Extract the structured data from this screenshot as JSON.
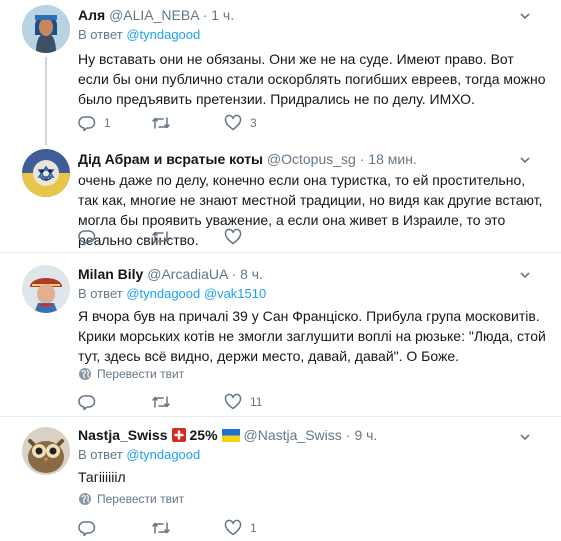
{
  "tweets": [
    {
      "name": "Аля",
      "badge": "",
      "handle": "@ALIA_NEBA",
      "dot": "·",
      "time": "1 ч.",
      "reply_prefix": "В ответ",
      "reply_to": "@tyndagood",
      "reply_to_2": "",
      "text": "Ну вставать они не обязаны. Они же не на суде. Имеют право. Вот если бы они публично стали оскорблять погибших евреев, тогда можно было предъявить претензии. Придрались не по делу. ИМХО.",
      "translate": "",
      "replies": "1",
      "retweets": "",
      "likes": "3"
    },
    {
      "name": "Дід Абрам и всратые коты",
      "badge": "",
      "handle": "@Octopus_sg",
      "dot": "·",
      "time": "18 мин.",
      "reply_prefix": "",
      "reply_to": "",
      "reply_to_2": "",
      "text": "очень даже по делу, конечно если она туристка, то ей простительно, так как, многие не знают местной традиции, но видя как другие встают, могла бы проявить уважение, а если она живет в Израиле, то это реально свинство.",
      "translate": "",
      "replies": "",
      "retweets": "",
      "likes": ""
    },
    {
      "name": "Milan Bily",
      "badge": "",
      "handle": "@ArcadiaUA",
      "dot": "·",
      "time": "8 ч.",
      "reply_prefix": "В ответ",
      "reply_to": "@tyndagood",
      "reply_to_2": "@vak1510",
      "text": "Я вчора був на причалі 39 у Сан Франціско. Прибула група московитів. Крики морських котів не змогли заглушити воплі на рюзьке: \"Люда, стой тут, здесь всё видно, держи место, давай, давай\". О Боже.",
      "translate": "Перевести твит",
      "replies": "",
      "retweets": "",
      "likes": "11"
    },
    {
      "name": "Nastja_Swiss",
      "badge": "25%",
      "handle": "@Nastja_Swiss",
      "dot": "·",
      "time": "9 ч.",
      "reply_prefix": "В ответ",
      "reply_to": "@tyndagood",
      "reply_to_2": "",
      "text": "Тагііііііл",
      "translate": "Перевести твит",
      "replies": "",
      "retweets": "",
      "likes": "1"
    }
  ],
  "colors": {
    "text": "#14171a",
    "secondary": "#657786",
    "link": "#1da1f2",
    "separator": "#e6ecf0",
    "thread_line": "#ccd6dd"
  },
  "icons": [
    "reply-icon",
    "retweet-icon",
    "like-icon",
    "caret-down-icon",
    "globe-icon",
    "swiss-flag-icon",
    "ukraine-flag-icon"
  ]
}
